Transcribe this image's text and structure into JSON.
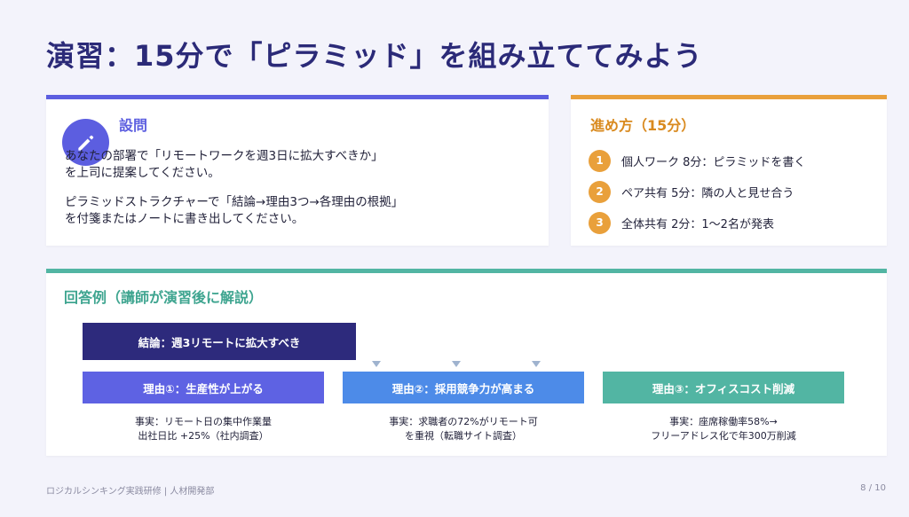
{
  "title": "演習：15分で「ピラミッド」を組み立ててみよう",
  "question": {
    "heading": "設問",
    "icon": "pencil-icon",
    "paragraph1": "あなたの部署で「リモートワークを週3日に拡大すべきか」\nを上司に提案してください。",
    "paragraph2": "ピラミッドストラクチャーで「結論→理由3つ→各理由の根拠」\nを付箋またはノートに書き出してください。"
  },
  "steps": {
    "heading": "進め方（15分）",
    "items": [
      {
        "num": "1",
        "text": "個人ワーク 8分：ピラミッドを書く"
      },
      {
        "num": "2",
        "text": "ペア共有 5分：隣の人と見せ合う"
      },
      {
        "num": "3",
        "text": "全体共有 2分：1〜2名が発表"
      }
    ]
  },
  "answer": {
    "heading": "回答例（講師が演習後に解説）",
    "conclusion": "結論：週3リモートに拡大すべき",
    "reasons": [
      {
        "label": "理由①：生産性が上がる",
        "fact": "事実：リモート日の集中作業量\n出社日比 +25%（社内調査）"
      },
      {
        "label": "理由②：採用競争力が高まる",
        "fact": "事実：求職者の72%がリモート可\nを重視（転職サイト調査）"
      },
      {
        "label": "理由③：オフィスコスト削減",
        "fact": "事実：座席稼働率58%→\nフリーアドレス化で年300万削減"
      }
    ]
  },
  "footer": {
    "left": "ロジカルシンキング実践研修 | 人材開発部",
    "page": "8 / 10"
  },
  "colors": {
    "accent_blue": "#5c5ee0",
    "accent_orange": "#e9a03b",
    "accent_teal": "#52b5a3",
    "navy": "#2d2a7c"
  }
}
